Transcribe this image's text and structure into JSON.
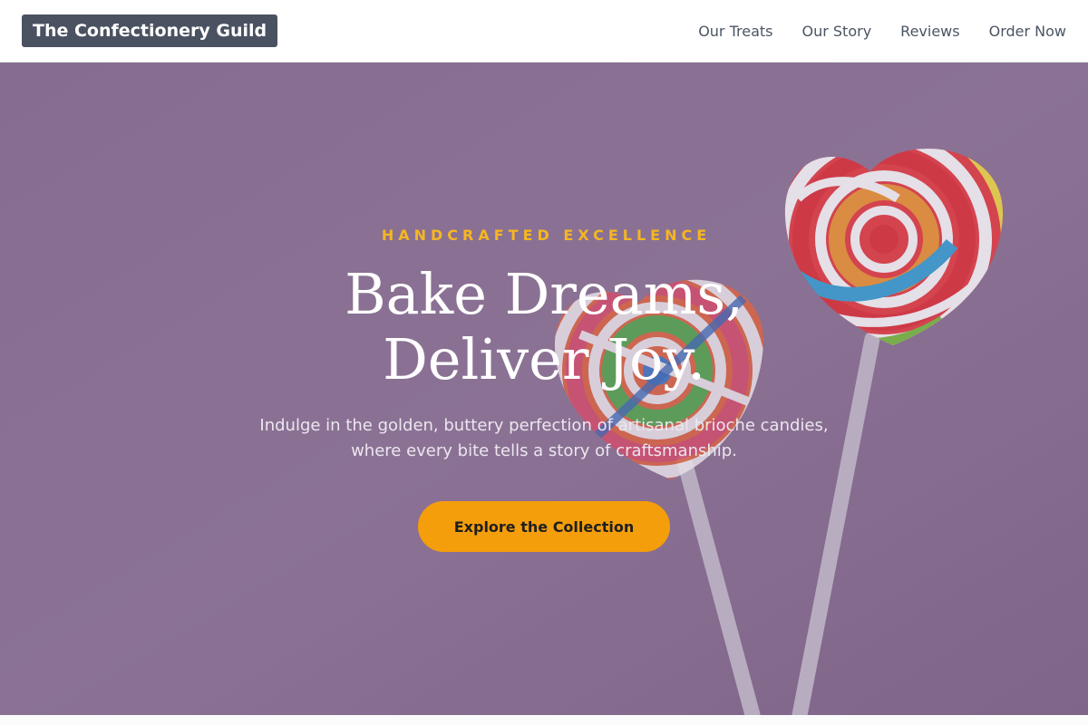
{
  "header": {
    "brand": "The Confectionery Guild",
    "nav": [
      {
        "label": "Our Treats"
      },
      {
        "label": "Our Story"
      },
      {
        "label": "Reviews"
      },
      {
        "label": "Order Now"
      }
    ]
  },
  "hero": {
    "eyebrow": "HANDCRAFTED EXCELLENCE",
    "headline_line1": "Bake Dreams,",
    "headline_line2": "Deliver Joy.",
    "description": "Indulge in the golden, buttery perfection of artisanal brioche candies, where every bite tells a story of craftsmanship.",
    "cta_label": "Explore the Collection",
    "background_image": "heart-shaped lollipops on pink background"
  },
  "colors": {
    "accent": "#f5b621",
    "cta": "#f59e0b",
    "brand_bg": "#4a5160",
    "hero_bg": "#8d7596"
  }
}
